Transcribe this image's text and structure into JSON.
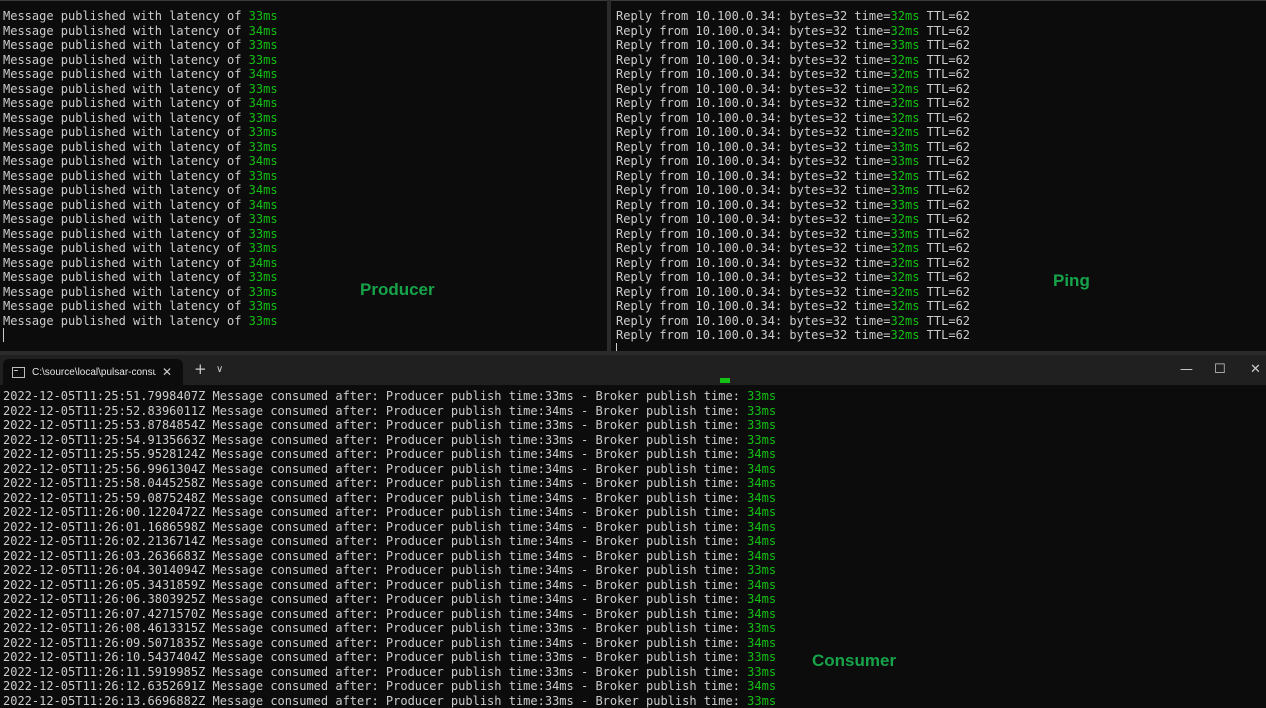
{
  "producer": {
    "label": "Producer",
    "lines": [
      {
        "text": "Message published with latency of ",
        "value": "33ms"
      },
      {
        "text": "Message published with latency of ",
        "value": "34ms"
      },
      {
        "text": "Message published with latency of ",
        "value": "33ms"
      },
      {
        "text": "Message published with latency of ",
        "value": "33ms"
      },
      {
        "text": "Message published with latency of ",
        "value": "34ms"
      },
      {
        "text": "Message published with latency of ",
        "value": "33ms"
      },
      {
        "text": "Message published with latency of ",
        "value": "34ms"
      },
      {
        "text": "Message published with latency of ",
        "value": "33ms"
      },
      {
        "text": "Message published with latency of ",
        "value": "33ms"
      },
      {
        "text": "Message published with latency of ",
        "value": "33ms"
      },
      {
        "text": "Message published with latency of ",
        "value": "34ms"
      },
      {
        "text": "Message published with latency of ",
        "value": "33ms"
      },
      {
        "text": "Message published with latency of ",
        "value": "34ms"
      },
      {
        "text": "Message published with latency of ",
        "value": "34ms"
      },
      {
        "text": "Message published with latency of ",
        "value": "33ms"
      },
      {
        "text": "Message published with latency of ",
        "value": "33ms"
      },
      {
        "text": "Message published with latency of ",
        "value": "33ms"
      },
      {
        "text": "Message published with latency of ",
        "value": "34ms"
      },
      {
        "text": "Message published with latency of ",
        "value": "33ms"
      },
      {
        "text": "Message published with latency of ",
        "value": "33ms"
      },
      {
        "text": "Message published with latency of ",
        "value": "33ms"
      },
      {
        "text": "Message published with latency of ",
        "value": "33ms"
      }
    ]
  },
  "ping": {
    "label": "Ping",
    "prefix": "Reply from 10.100.0.34: bytes=32 time=",
    "suffix": " TTL=62",
    "times": [
      "32ms",
      "32ms",
      "33ms",
      "32ms",
      "32ms",
      "32ms",
      "32ms",
      "32ms",
      "32ms",
      "33ms",
      "33ms",
      "32ms",
      "33ms",
      "33ms",
      "32ms",
      "33ms",
      "32ms",
      "32ms",
      "32ms",
      "32ms",
      "32ms",
      "32ms",
      "32ms"
    ]
  },
  "window": {
    "tab_title": "C:\\source\\local\\pulsar-consur",
    "tab_close": "✕",
    "new_tab": "+",
    "dropdown": "∨",
    "minimize": "—",
    "maximize": "☐",
    "close": "✕"
  },
  "consumer": {
    "label": "Consumer",
    "mid": " Message consumed after: Producer publish time:",
    "broker": " - Broker publish time: ",
    "lines": [
      {
        "ts": "2022-12-05T11:25:51.7998407Z",
        "producer": "33ms",
        "broker": "33ms"
      },
      {
        "ts": "2022-12-05T11:25:52.8396011Z",
        "producer": "34ms",
        "broker": "33ms"
      },
      {
        "ts": "2022-12-05T11:25:53.8784854Z",
        "producer": "33ms",
        "broker": "33ms"
      },
      {
        "ts": "2022-12-05T11:25:54.9135663Z",
        "producer": "33ms",
        "broker": "33ms"
      },
      {
        "ts": "2022-12-05T11:25:55.9528124Z",
        "producer": "34ms",
        "broker": "34ms"
      },
      {
        "ts": "2022-12-05T11:25:56.9961304Z",
        "producer": "34ms",
        "broker": "34ms"
      },
      {
        "ts": "2022-12-05T11:25:58.0445258Z",
        "producer": "34ms",
        "broker": "34ms"
      },
      {
        "ts": "2022-12-05T11:25:59.0875248Z",
        "producer": "34ms",
        "broker": "34ms"
      },
      {
        "ts": "2022-12-05T11:26:00.1220472Z",
        "producer": "34ms",
        "broker": "34ms"
      },
      {
        "ts": "2022-12-05T11:26:01.1686598Z",
        "producer": "34ms",
        "broker": "34ms"
      },
      {
        "ts": "2022-12-05T11:26:02.2136714Z",
        "producer": "34ms",
        "broker": "34ms"
      },
      {
        "ts": "2022-12-05T11:26:03.2636683Z",
        "producer": "34ms",
        "broker": "34ms"
      },
      {
        "ts": "2022-12-05T11:26:04.3014094Z",
        "producer": "34ms",
        "broker": "33ms"
      },
      {
        "ts": "2022-12-05T11:26:05.3431859Z",
        "producer": "34ms",
        "broker": "34ms"
      },
      {
        "ts": "2022-12-05T11:26:06.3803925Z",
        "producer": "34ms",
        "broker": "34ms"
      },
      {
        "ts": "2022-12-05T11:26:07.4271570Z",
        "producer": "34ms",
        "broker": "34ms"
      },
      {
        "ts": "2022-12-05T11:26:08.4613315Z",
        "producer": "33ms",
        "broker": "33ms"
      },
      {
        "ts": "2022-12-05T11:26:09.5071835Z",
        "producer": "34ms",
        "broker": "34ms"
      },
      {
        "ts": "2022-12-05T11:26:10.5437404Z",
        "producer": "33ms",
        "broker": "33ms"
      },
      {
        "ts": "2022-12-05T11:26:11.5919985Z",
        "producer": "33ms",
        "broker": "33ms"
      },
      {
        "ts": "2022-12-05T11:26:12.6352691Z",
        "producer": "34ms",
        "broker": "34ms"
      },
      {
        "ts": "2022-12-05T11:26:13.6696882Z",
        "producer": "33ms",
        "broker": "33ms"
      }
    ]
  }
}
